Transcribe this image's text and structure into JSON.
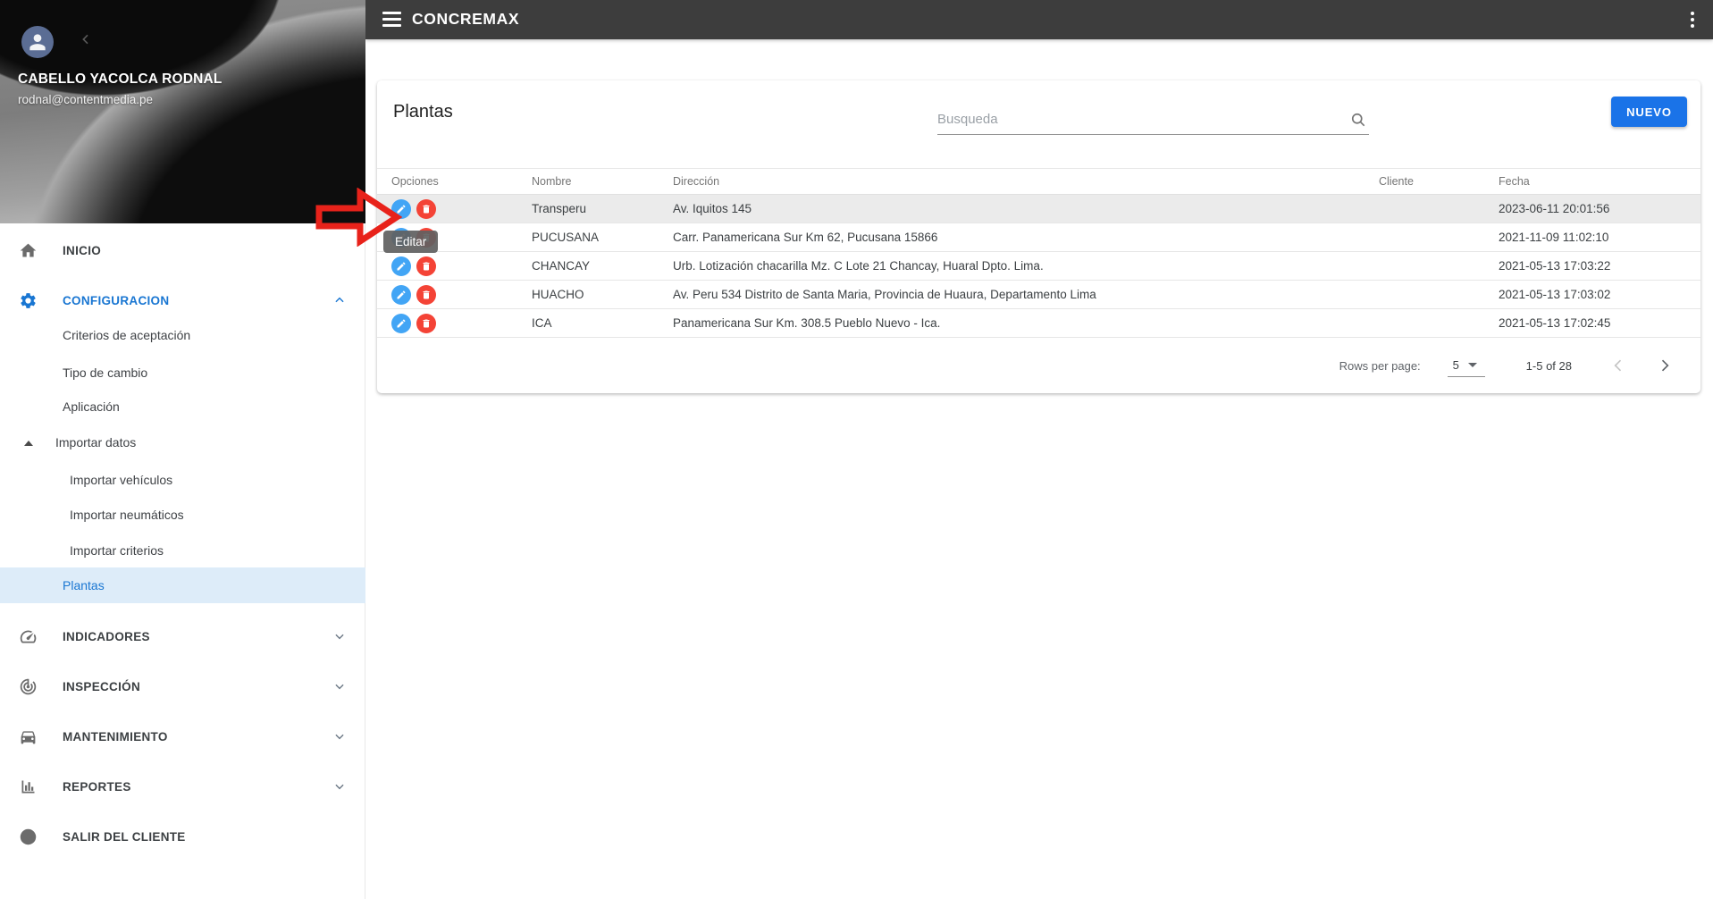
{
  "topbar": {
    "title": "CONCREMAX"
  },
  "user": {
    "name": "CABELLO YACOLCA RODNAL",
    "email": "rodnal@contentmedia.pe"
  },
  "sidebar": {
    "inicio": "INICIO",
    "configuracion": "CONFIGURACION",
    "criterios_aceptacion": "Criterios de aceptación",
    "tipo_cambio": "Tipo de cambio",
    "aplicacion": "Aplicación",
    "importar_datos": "Importar datos",
    "importar_vehiculos": "Importar vehículos",
    "importar_neumaticos": "Importar neumáticos",
    "importar_criterios": "Importar criterios",
    "plantas": "Plantas",
    "indicadores": "INDICADORES",
    "inspeccion": "INSPECCIÓN",
    "mantenimiento": "MANTENIMIENTO",
    "reportes": "REPORTES",
    "salir_cliente": "SALIR DEL CLIENTE"
  },
  "main": {
    "title": "Plantas",
    "search_placeholder": "Busqueda",
    "new_button_label": "NUEVO",
    "edit_tooltip": "Editar",
    "table": {
      "headers": [
        "Opciones",
        "Nombre",
        "Dirección",
        "Cliente",
        "Fecha"
      ],
      "rows": [
        {
          "nombre": "Transperu",
          "direccion": "Av. Iquitos 145",
          "cliente": "",
          "fecha": "2023-06-11 20:01:56"
        },
        {
          "nombre": "PUCUSANA",
          "direccion": "Carr. Panamericana Sur Km 62, Pucusana 15866",
          "cliente": "",
          "fecha": "2021-11-09 11:02:10"
        },
        {
          "nombre": "CHANCAY",
          "direccion": "Urb. Lotización chacarilla Mz. C Lote 21 Chancay, Huaral Dpto. Lima.",
          "cliente": "",
          "fecha": "2021-05-13 17:03:22"
        },
        {
          "nombre": "HUACHO",
          "direccion": "Av. Peru 534 Distrito de Santa Maria, Provincia de Huaura, Departamento Lima",
          "cliente": "",
          "fecha": "2021-05-13 17:03:02"
        },
        {
          "nombre": "ICA",
          "direccion": "Panamericana Sur Km. 308.5 Pueblo Nuevo - Ica.",
          "cliente": "",
          "fecha": "2021-05-13 17:02:45"
        }
      ]
    },
    "pagination": {
      "rows_per_page_label": "Rows per page:",
      "rows_per_page_value": "5",
      "range_label": "1-5 of 28"
    }
  },
  "colors": {
    "topbar_bg": "#3d3d3d",
    "accent_blue": "#1a73e8",
    "edit_button_blue": "#42a5f5",
    "delete_button_red": "#f44336",
    "selected_item_bg": "#ddecf9",
    "annotation_arrow_red": "#e8221a",
    "tooltip_bg": "#616161"
  }
}
